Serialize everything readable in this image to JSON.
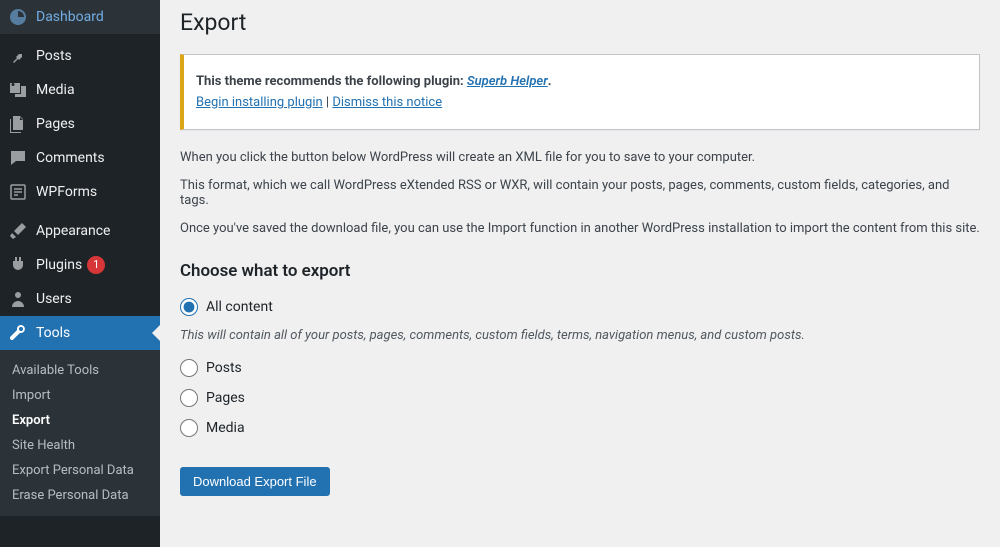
{
  "sidebar": {
    "items": [
      {
        "label": "Dashboard",
        "icon": "dashboard"
      },
      {
        "label": "Posts",
        "icon": "pin"
      },
      {
        "label": "Media",
        "icon": "media"
      },
      {
        "label": "Pages",
        "icon": "pages"
      },
      {
        "label": "Comments",
        "icon": "comment"
      },
      {
        "label": "WPForms",
        "icon": "wpforms"
      },
      {
        "label": "Appearance",
        "icon": "brush"
      },
      {
        "label": "Plugins",
        "icon": "plugin",
        "badge": "1"
      },
      {
        "label": "Users",
        "icon": "user"
      },
      {
        "label": "Tools",
        "icon": "wrench",
        "active": true
      }
    ],
    "submenu": [
      {
        "label": "Available Tools"
      },
      {
        "label": "Import"
      },
      {
        "label": "Export",
        "current": true
      },
      {
        "label": "Site Health"
      },
      {
        "label": "Export Personal Data"
      },
      {
        "label": "Erase Personal Data"
      }
    ]
  },
  "page": {
    "title": "Export",
    "notice": {
      "intro": "This theme recommends the following plugin: ",
      "plugin_name": "Superb Helper",
      "period": ".",
      "install_link": "Begin installing plugin",
      "separator": " | ",
      "dismiss_link": "Dismiss this notice"
    },
    "desc1": "When you click the button below WordPress will create an XML file for you to save to your computer.",
    "desc2": "This format, which we call WordPress eXtended RSS or WXR, will contain your posts, pages, comments, custom fields, categories, and tags.",
    "desc3": "Once you've saved the download file, you can use the Import function in another WordPress installation to import the content from this site.",
    "choose_heading": "Choose what to export",
    "options": {
      "all": "All content",
      "all_hint": "This will contain all of your posts, pages, comments, custom fields, terms, navigation menus, and custom posts.",
      "posts": "Posts",
      "pages": "Pages",
      "media": "Media"
    },
    "download_button": "Download Export File"
  }
}
